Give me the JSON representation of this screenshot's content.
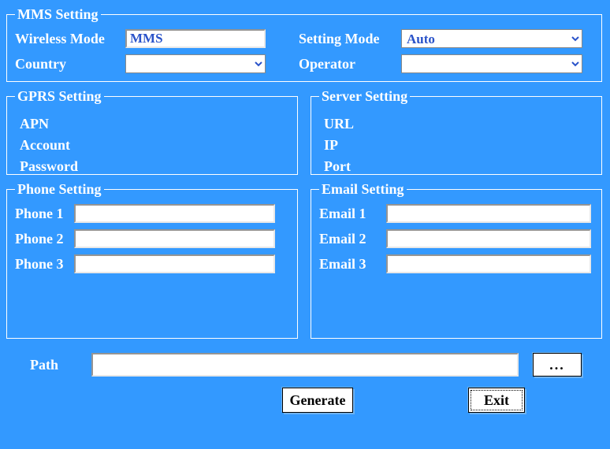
{
  "mms": {
    "legend": "MMS Setting",
    "wirelessModeLabel": "Wireless Mode",
    "wirelessModeValue": "MMS",
    "settingModeLabel": "Setting Mode",
    "settingModeValue": "Auto",
    "countryLabel": "Country",
    "countryValue": "",
    "operatorLabel": "Operator",
    "operatorValue": ""
  },
  "gprs": {
    "legend": "GPRS Setting",
    "apnLabel": "APN",
    "accountLabel": "Account",
    "passwordLabel": "Password"
  },
  "server": {
    "legend": "Server Setting",
    "urlLabel": "URL",
    "ipLabel": "IP",
    "portLabel": "Port"
  },
  "phone": {
    "legend": "Phone Setting",
    "items": [
      {
        "label": "Phone 1",
        "value": ""
      },
      {
        "label": "Phone 2",
        "value": ""
      },
      {
        "label": "Phone 3",
        "value": ""
      }
    ]
  },
  "email": {
    "legend": "Email Setting",
    "items": [
      {
        "label": "Email 1",
        "value": ""
      },
      {
        "label": "Email 2",
        "value": ""
      },
      {
        "label": "Email 3",
        "value": ""
      }
    ]
  },
  "path": {
    "label": "Path",
    "value": "",
    "browseLabel": "..."
  },
  "buttons": {
    "generate": "Generate",
    "exit": "Exit"
  }
}
